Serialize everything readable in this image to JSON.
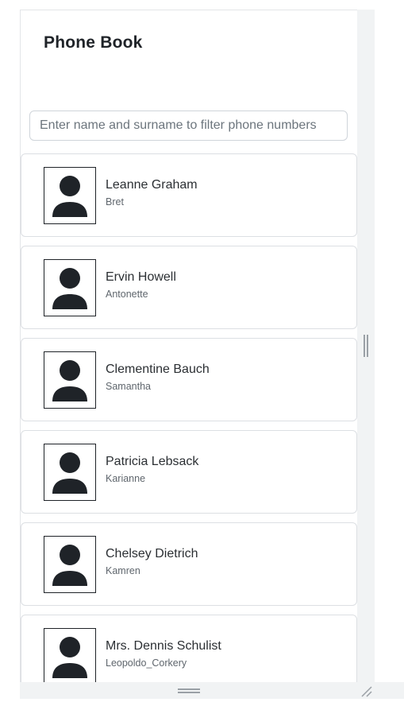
{
  "app": {
    "title": "Phone Book"
  },
  "search": {
    "placeholder": "Enter name and surname to filter phone numbers",
    "value": ""
  },
  "contacts": [
    {
      "name": "Leanne Graham",
      "username": "Bret",
      "avatar_icon": "person-icon"
    },
    {
      "name": "Ervin Howell",
      "username": "Antonette",
      "avatar_icon": "person-icon"
    },
    {
      "name": "Clementine Bauch",
      "username": "Samantha",
      "avatar_icon": "person-icon"
    },
    {
      "name": "Patricia Lebsack",
      "username": "Karianne",
      "avatar_icon": "person-icon"
    },
    {
      "name": "Chelsey Dietrich",
      "username": "Kamren",
      "avatar_icon": "person-icon"
    },
    {
      "name": "Mrs. Dennis Schulist",
      "username": "Leopoldo_Corkery",
      "avatar_icon": "person-icon"
    }
  ],
  "colors": {
    "text": "#2b2f33",
    "muted": "#5f666d",
    "border": "#dcdfe3",
    "icon": "#1f2328"
  }
}
